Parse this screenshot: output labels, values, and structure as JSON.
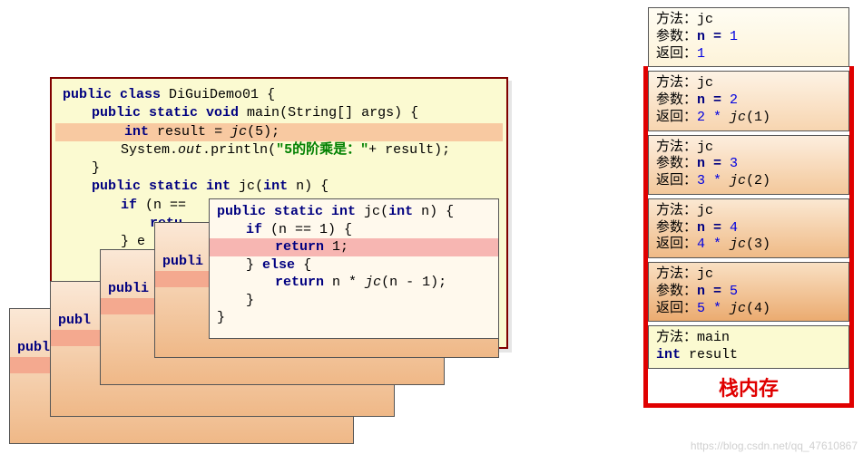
{
  "main_code": {
    "class_decl": [
      "public class",
      "DiGuiDemo01",
      "{"
    ],
    "main_sig": [
      "public static void",
      "main",
      "(String[] args) {"
    ],
    "hl_line1": {
      "kw": "int",
      "var": "result",
      "eq": "=",
      "fn": "jc",
      "args": "(5);"
    },
    "println": {
      "obj": "System",
      "dot1": ".",
      "out": "out",
      "dot2": ".",
      "fn": "println",
      "open": "(",
      "str": "\"5的阶乘是：\"",
      "plus": "+ result);"
    },
    "close1": "}",
    "jc_sig": [
      "public static int",
      "jc",
      "(",
      "int",
      "n) {"
    ],
    "if": [
      "if",
      "(n =="
    ],
    "ret": "retu",
    "else": "} e",
    "tail_pub": "publi"
  },
  "top_card": {
    "sig": [
      "public static int",
      "jc",
      "(",
      "int",
      "n) {"
    ],
    "if": [
      "if",
      "(n == 1) {"
    ],
    "ret1": [
      "return",
      "1;"
    ],
    "else": [
      "}",
      "else",
      "{"
    ],
    "retn": [
      "return",
      "n *",
      "jc",
      "(n - 1);"
    ],
    "c1": "}",
    "c2": "}"
  },
  "peek": {
    "pub": "publ",
    "publi": "publi"
  },
  "stack": {
    "frames": [
      {
        "cls": "top",
        "m": "jc",
        "p_lbl": "n = ",
        "p_val": "1",
        "r": "1",
        "r_tail": ""
      },
      {
        "cls": "o1",
        "m": "jc",
        "p_lbl": "n = ",
        "p_val": "2",
        "r": "2 * ",
        "r_fn": "jc",
        "r_tail": "(1)"
      },
      {
        "cls": "o2",
        "m": "jc",
        "p_lbl": "n = ",
        "p_val": "3",
        "r": "3 * ",
        "r_fn": "jc",
        "r_tail": "(2)"
      },
      {
        "cls": "o3",
        "m": "jc",
        "p_lbl": "n = ",
        "p_val": "4",
        "r": "4 * ",
        "r_fn": "jc",
        "r_tail": "(3)"
      },
      {
        "cls": "o4",
        "m": "jc",
        "p_lbl": "n = ",
        "p_val": "5",
        "r": "5 * ",
        "r_fn": "jc",
        "r_tail": "(4)"
      }
    ],
    "main": {
      "m": "main",
      "decl_kw": "int",
      "decl_var": "result"
    },
    "labels": {
      "method": "方法：",
      "param": "参数：",
      "ret": "返回："
    },
    "title": "栈内存"
  },
  "watermark": "https://blog.csdn.net/qq_47610867"
}
